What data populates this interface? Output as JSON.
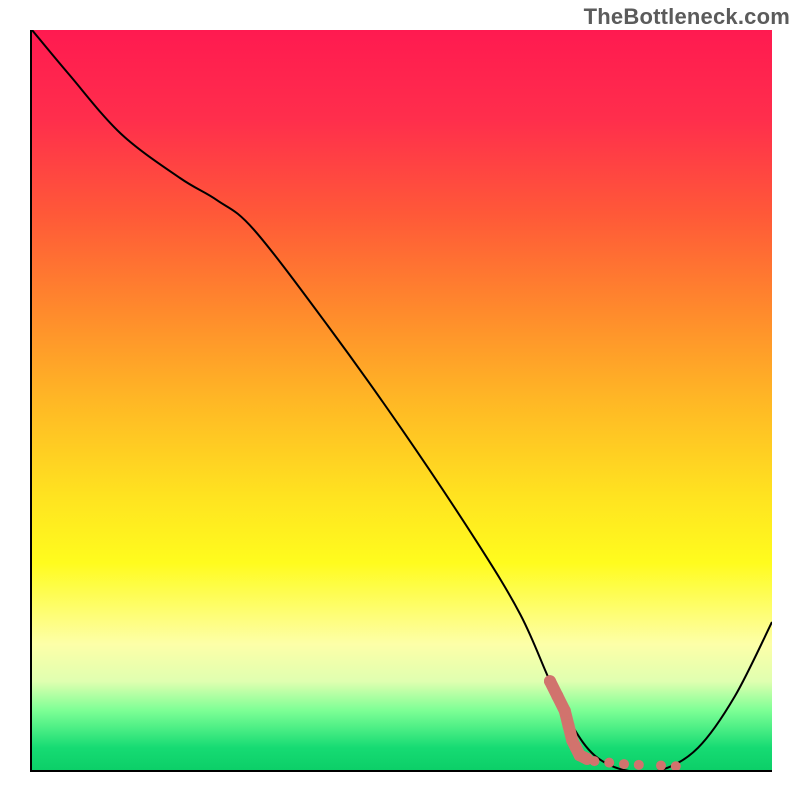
{
  "watermark": "TheBottleneck.com",
  "chart_data": {
    "type": "line",
    "title": "",
    "xlabel": "",
    "ylabel": "",
    "xlim": [
      0,
      100
    ],
    "ylim": [
      0,
      100
    ],
    "grid": false,
    "legend": false,
    "series": [
      {
        "name": "bottleneck-curve",
        "color": "#000000",
        "x": [
          0,
          5,
          12,
          20,
          25,
          30,
          40,
          50,
          60,
          66,
          70,
          73,
          76,
          80,
          85,
          90,
          95,
          100
        ],
        "y": [
          100,
          94,
          86,
          80,
          77,
          73,
          60,
          46,
          31,
          21,
          12,
          6,
          2,
          0,
          0,
          3,
          10,
          20
        ]
      }
    ],
    "annotations": [
      {
        "name": "flat-min-marker",
        "type": "dots",
        "color": "#d1736d",
        "points": [
          {
            "x": 70,
            "y": 12
          },
          {
            "x": 71,
            "y": 10
          },
          {
            "x": 72,
            "y": 8
          },
          {
            "x": 72.5,
            "y": 6
          },
          {
            "x": 73,
            "y": 4
          },
          {
            "x": 73.5,
            "y": 3
          },
          {
            "x": 74,
            "y": 2
          },
          {
            "x": 75,
            "y": 1.5
          },
          {
            "x": 76,
            "y": 1.2
          },
          {
            "x": 78,
            "y": 1
          },
          {
            "x": 80,
            "y": 0.8
          },
          {
            "x": 82,
            "y": 0.7
          },
          {
            "x": 85,
            "y": 0.6
          },
          {
            "x": 87,
            "y": 0.5
          }
        ]
      }
    ],
    "background_gradient_stops": [
      {
        "pct": 0,
        "color": "#ff1a50"
      },
      {
        "pct": 50,
        "color": "#ffb725"
      },
      {
        "pct": 80,
        "color": "#fffc1e"
      },
      {
        "pct": 95,
        "color": "#3de07c"
      },
      {
        "pct": 100,
        "color": "#0ccf68"
      }
    ]
  }
}
